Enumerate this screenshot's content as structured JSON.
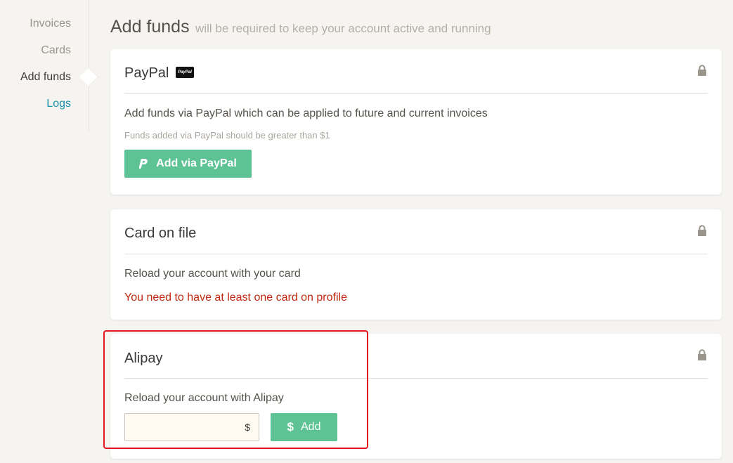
{
  "sidebar": {
    "items": [
      {
        "label": "Invoices"
      },
      {
        "label": "Cards"
      },
      {
        "label": "Add funds"
      },
      {
        "label": "Logs"
      }
    ]
  },
  "header": {
    "title": "Add funds",
    "subtitle": "will be required to keep your account active and running"
  },
  "paypal": {
    "title": "PayPal",
    "badge": "PayPal",
    "description": "Add funds via PayPal which can be applied to future and current invoices",
    "note": "Funds added via PayPal should be greater than $1",
    "button_label": "Add via PayPal"
  },
  "card_on_file": {
    "title": "Card on file",
    "description": "Reload your account with your card",
    "error": "You need to have at least one card on profile"
  },
  "alipay": {
    "title": "Alipay",
    "description": "Reload your account with Alipay",
    "amount_value": "",
    "currency_symbol": "$",
    "button_label": "Add"
  },
  "colors": {
    "accent_green": "#5dc394",
    "link_blue": "#1b8fa8",
    "error_red": "#c0290f",
    "highlight_red": "#e3161d"
  },
  "icons": {
    "lock": "lock-icon",
    "paypal": "paypal-p-icon",
    "dollar": "dollar-icon"
  }
}
